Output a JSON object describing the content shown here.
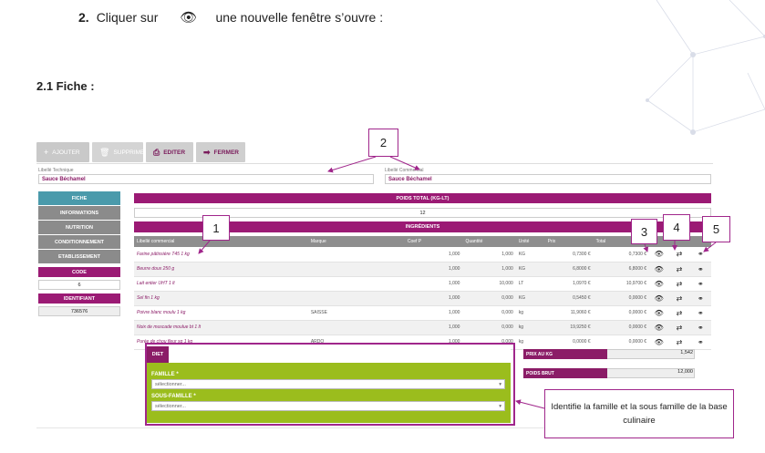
{
  "step": {
    "number": "2.",
    "text_before": "Cliquer sur",
    "text_after": "une nouvelle fenêtre s’ouvre :"
  },
  "section": {
    "title": "2.1 Fiche :"
  },
  "toolbar": {
    "add": "AJOUTER",
    "delete": "SUPPRIMER",
    "edit": "EDITER",
    "close": "FERMER"
  },
  "fields": {
    "tech_label": "Libellé Technique",
    "tech_value": "Sauce Béchamel",
    "comm_label": "Libellé Commercial",
    "comm_value": "Sauce Béchamel"
  },
  "sidebar": {
    "items": [
      "FICHE",
      "INFORMATIONS",
      "NUTRITION",
      "CONDITIONNEMENT",
      "ETABLISSEMENT"
    ],
    "code_label": "CODE",
    "code_value": "6",
    "id_label": "IDENTIFIANT",
    "id_value": "736576"
  },
  "poids": {
    "title": "POIDS TOTAL (KG-LT)",
    "value": "12"
  },
  "ingredients": {
    "title": "INGRÉDIENTS",
    "headers": [
      "Libellé commercial",
      "Marque",
      "Coef P",
      "Quantité",
      "Unité",
      "Prix",
      "Total",
      "",
      "",
      ""
    ],
    "rows": [
      [
        "Farine pâtissière T45 1 kg",
        "",
        "1,000",
        "1,000",
        "KG",
        "0,7300 €",
        "0,7300 €"
      ],
      [
        "Beurre doux 250 g",
        "",
        "1,000",
        "1,000",
        "KG",
        "6,8000 €",
        "6,8000 €"
      ],
      [
        "Lait entier UHT 1 lt",
        "",
        "1,000",
        "10,000",
        "LT",
        "1,0970 €",
        "10,9700 €"
      ],
      [
        "Sel fin 1 kg",
        "",
        "1,000",
        "0,000",
        "KG",
        "0,5450 €",
        "0,0000 €"
      ],
      [
        "Poivre blanc moulu 1 kg",
        "SAISSE",
        "1,000",
        "0,000",
        "kg",
        "11,9060 €",
        "0,0000 €"
      ],
      [
        "Noix de muscade moulue bt 1 lt",
        "",
        "1,000",
        "0,000",
        "kg",
        "19,9250 €",
        "0,0000 €"
      ],
      [
        "Purée de chou fleur sg 1 kg",
        "ARDO",
        "1,000",
        "0,000",
        "kg",
        "0,0000 €",
        "0,0000 €"
      ]
    ]
  },
  "diet": {
    "tab": "DIET",
    "famille_label": "FAMILLE *",
    "famille_placeholder": "sélectionner...",
    "sous_famille_label": "SOUS-FAMILLE *",
    "sous_famille_placeholder": "sélectionner..."
  },
  "metrics": {
    "prix_label": "PRIX AU KG",
    "prix_value": "1,542",
    "poids_label": "POIDS BRUT",
    "poids_value": "12,000"
  },
  "callouts": {
    "n1": "1",
    "n2": "2",
    "n3": "3",
    "n4": "4",
    "n5": "5",
    "text": "Identifie la famille et la sous famille de la base culinaire"
  },
  "colors": {
    "accent": "#9b1a74",
    "green": "#9bbd1d",
    "teal": "#4a9aab",
    "callout": "#a0268b"
  }
}
